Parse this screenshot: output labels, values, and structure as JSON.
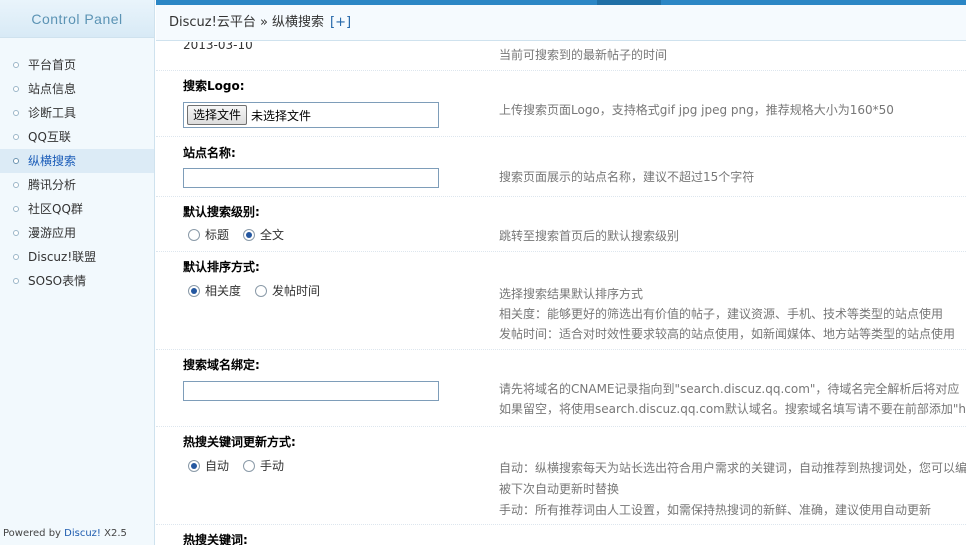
{
  "sidebar": {
    "title": "Control Panel",
    "items": [
      {
        "label": "平台首页"
      },
      {
        "label": "站点信息"
      },
      {
        "label": "诊断工具"
      },
      {
        "label": "QQ互联"
      },
      {
        "label": "纵横搜索",
        "active": true
      },
      {
        "label": "腾讯分析"
      },
      {
        "label": "社区QQ群"
      },
      {
        "label": "漫游应用"
      },
      {
        "label": "Discuz!联盟"
      },
      {
        "label": "SOSO表情"
      }
    ],
    "powered_prefix": "Powered by ",
    "powered_brand": "Discuz!",
    "powered_version": " X2.5"
  },
  "breadcrumb": {
    "text": "Discuz!云平台 » 纵横搜索",
    "add_label": "[+]"
  },
  "settings": {
    "latest_date": {
      "value": "2013-03-10",
      "tip": "当前可搜索到的最新帖子的时间"
    },
    "search_logo": {
      "label": "搜索Logo:",
      "button_label": "选择文件",
      "file_status": "未选择文件",
      "tip": "上传搜索页面Logo，支持格式gif jpg jpeg png，推荐规格大小为160*50"
    },
    "site_name": {
      "label": "站点名称:",
      "value": "",
      "tip": "搜索页面展示的站点名称，建议不超过15个字符"
    },
    "default_level": {
      "label": "默认搜索级别:",
      "options": [
        "标题",
        "全文"
      ],
      "selected": "全文",
      "tip": "跳转至搜索首页后的默认搜索级别"
    },
    "default_sort": {
      "label": "默认排序方式:",
      "options": [
        "相关度",
        "发帖时间"
      ],
      "selected": "相关度",
      "tips": [
        "选择搜索结果默认排序方式",
        "相关度：能够更好的筛选出有价值的帖子，建议资源、手机、技术等类型的站点使用",
        "发帖时间：适合对时效性要求较高的站点使用，如新闻媒体、地方站等类型的站点使用"
      ]
    },
    "domain_bind": {
      "label": "搜索域名绑定:",
      "value": "",
      "tips": [
        "请先将域名的CNAME记录指向到\"search.discuz.qq.com\"，待域名完全解析后将对应",
        "如果留空，将使用search.discuz.qq.com默认域名。搜索域名填写请不要在前部添加\"h"
      ]
    },
    "hot_keyword_mode": {
      "label": "热搜关键词更新方式:",
      "options": [
        "自动",
        "手动"
      ],
      "selected": "自动",
      "tips": [
        "自动：纵横搜索每天为站长选出符合用户需求的关键词，自动推荐到热搜词处，您可以编",
        "被下次自动更新时替换",
        "手动：所有推荐词由人工设置，如需保持热搜词的新鲜、准确，建议使用自动更新"
      ]
    },
    "hot_keywords": {
      "label": "热搜关键词:"
    }
  },
  "colors": {
    "accent": "#2b86c5",
    "sidebar_bg": "#f2f9fd",
    "active_item_bg": "#dcebf6",
    "link": "#1b5aae"
  }
}
